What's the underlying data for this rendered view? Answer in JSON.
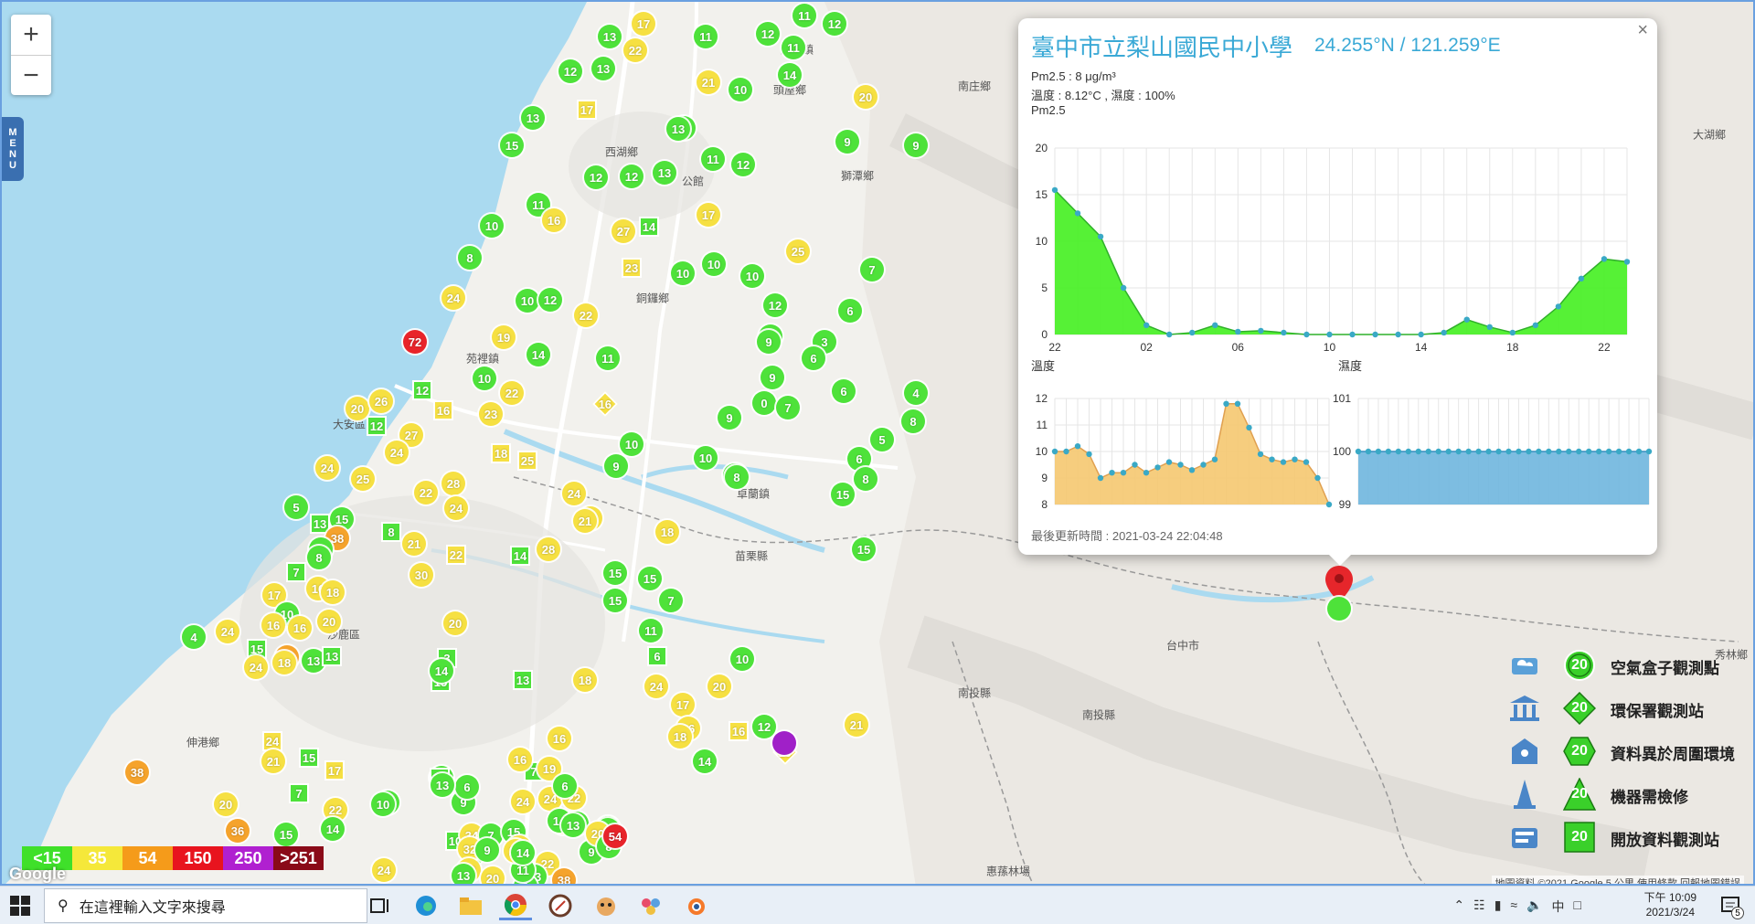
{
  "map": {
    "zoom_in": "+",
    "zoom_out": "−",
    "menu_label": "MENU",
    "places": [
      {
        "name": "通霄鎮"
      },
      {
        "name": "南庄鄉"
      },
      {
        "name": "頭屋鄉"
      },
      {
        "name": "西湖鄉"
      },
      {
        "name": "獅潭鄉"
      },
      {
        "name": "公館"
      },
      {
        "name": "大湖鄉"
      },
      {
        "name": "銅鑼鄉"
      },
      {
        "name": "苑裡鎮"
      },
      {
        "name": "大安區"
      },
      {
        "name": "卓蘭鎮"
      },
      {
        "name": "苗栗縣"
      },
      {
        "name": "台中市"
      },
      {
        "name": "沙鹿區"
      },
      {
        "name": "伸港鄉"
      },
      {
        "name": "南投縣"
      },
      {
        "name": "南投縣"
      },
      {
        "name": "惠蓀林場"
      },
      {
        "name": "秀林鄉"
      }
    ],
    "markers": [
      {
        "v": "13",
        "lv": 1,
        "t": "c"
      },
      {
        "v": "17",
        "lv": 2,
        "t": "c"
      },
      {
        "v": "22",
        "lv": 2,
        "t": "c"
      },
      {
        "v": "11",
        "lv": 1,
        "t": "c"
      },
      {
        "v": "12",
        "lv": 1,
        "t": "c"
      },
      {
        "v": "11",
        "lv": 1,
        "t": "c"
      },
      {
        "v": "12",
        "lv": 1,
        "t": "c"
      },
      {
        "v": "11",
        "lv": 1,
        "t": "c"
      },
      {
        "v": "14",
        "lv": 1,
        "t": "c"
      },
      {
        "v": "13",
        "lv": 1,
        "t": "c"
      },
      {
        "v": "12",
        "lv": 1,
        "t": "c"
      },
      {
        "v": "13",
        "lv": 1,
        "t": "c"
      },
      {
        "v": "15",
        "lv": 1,
        "t": "c"
      },
      {
        "v": "17",
        "lv": 2,
        "t": "s"
      },
      {
        "v": "21",
        "lv": 2,
        "t": "c"
      },
      {
        "v": "10",
        "lv": 1,
        "t": "c"
      },
      {
        "v": "20",
        "lv": 2,
        "t": "c"
      },
      {
        "v": "12",
        "lv": 1,
        "t": "c"
      },
      {
        "v": "13",
        "lv": 1,
        "t": "c"
      },
      {
        "v": "9",
        "lv": 1,
        "t": "c"
      },
      {
        "v": "9",
        "lv": 1,
        "t": "c"
      },
      {
        "v": "11",
        "lv": 1,
        "t": "c"
      },
      {
        "v": "12",
        "lv": 1,
        "t": "c"
      },
      {
        "v": "12",
        "lv": 1,
        "t": "c"
      },
      {
        "v": "12",
        "lv": 1,
        "t": "c"
      },
      {
        "v": "13",
        "lv": 1,
        "t": "c"
      },
      {
        "v": "10",
        "lv": 1,
        "t": "c"
      },
      {
        "v": "11",
        "lv": 1,
        "t": "c"
      },
      {
        "v": "16",
        "lv": 2,
        "t": "c"
      },
      {
        "v": "27",
        "lv": 2,
        "t": "c"
      },
      {
        "v": "14",
        "lv": 1,
        "t": "s"
      },
      {
        "v": "17",
        "lv": 2,
        "t": "c"
      },
      {
        "v": "8",
        "lv": 1,
        "t": "c"
      },
      {
        "v": "23",
        "lv": 2,
        "t": "s"
      },
      {
        "v": "10",
        "lv": 1,
        "t": "c"
      },
      {
        "v": "10",
        "lv": 1,
        "t": "c"
      },
      {
        "v": "10",
        "lv": 1,
        "t": "c"
      },
      {
        "v": "25",
        "lv": 2,
        "t": "c"
      },
      {
        "v": "7",
        "lv": 1,
        "t": "c"
      },
      {
        "v": "72",
        "lv": 4,
        "t": "c"
      },
      {
        "v": "24",
        "lv": 2,
        "t": "c"
      },
      {
        "v": "10",
        "lv": 1,
        "t": "c"
      },
      {
        "v": "12",
        "lv": 1,
        "t": "c"
      },
      {
        "v": "22",
        "lv": 2,
        "t": "c"
      },
      {
        "v": "12",
        "lv": 1,
        "t": "c"
      },
      {
        "v": "6",
        "lv": 1,
        "t": "c"
      },
      {
        "v": "9",
        "lv": 1,
        "t": "c"
      },
      {
        "v": "9",
        "lv": 1,
        "t": "c"
      },
      {
        "v": "3",
        "lv": 1,
        "t": "c"
      },
      {
        "v": "6",
        "lv": 1,
        "t": "c"
      },
      {
        "v": "19",
        "lv": 2,
        "t": "c"
      },
      {
        "v": "10",
        "lv": 1,
        "t": "c"
      },
      {
        "v": "14",
        "lv": 1,
        "t": "c"
      },
      {
        "v": "11",
        "lv": 1,
        "t": "c"
      },
      {
        "v": "12",
        "lv": 1,
        "t": "s"
      },
      {
        "v": "22",
        "lv": 2,
        "t": "c"
      },
      {
        "v": "16",
        "lv": 2,
        "t": "d"
      },
      {
        "v": "9",
        "lv": 1,
        "t": "c"
      },
      {
        "v": "9",
        "lv": 1,
        "t": "c"
      },
      {
        "v": "0",
        "lv": 1,
        "t": "c"
      },
      {
        "v": "7",
        "lv": 1,
        "t": "c"
      },
      {
        "v": "6",
        "lv": 1,
        "t": "c"
      },
      {
        "v": "4",
        "lv": 1,
        "t": "c"
      },
      {
        "v": "8",
        "lv": 1,
        "t": "c"
      },
      {
        "v": "20",
        "lv": 2,
        "t": "c"
      },
      {
        "v": "26",
        "lv": 2,
        "t": "c"
      },
      {
        "v": "12",
        "lv": 1,
        "t": "s"
      },
      {
        "v": "27",
        "lv": 2,
        "t": "c"
      },
      {
        "v": "16",
        "lv": 2,
        "t": "s"
      },
      {
        "v": "23",
        "lv": 2,
        "t": "c"
      },
      {
        "v": "10",
        "lv": 1,
        "t": "c"
      },
      {
        "v": "9",
        "lv": 1,
        "t": "c"
      },
      {
        "v": "5",
        "lv": 1,
        "t": "c"
      },
      {
        "v": "6",
        "lv": 1,
        "t": "c"
      },
      {
        "v": "8",
        "lv": 1,
        "t": "c"
      },
      {
        "v": "24",
        "lv": 2,
        "t": "c"
      },
      {
        "v": "25",
        "lv": 2,
        "t": "c"
      },
      {
        "v": "24",
        "lv": 2,
        "t": "c"
      },
      {
        "v": "18",
        "lv": 2,
        "t": "s"
      },
      {
        "v": "25",
        "lv": 2,
        "t": "s"
      },
      {
        "v": "10",
        "lv": 1,
        "t": "c"
      },
      {
        "v": "9",
        "lv": 1,
        "t": "c"
      },
      {
        "v": "8",
        "lv": 1,
        "t": "c"
      },
      {
        "v": "15",
        "lv": 1,
        "t": "c"
      },
      {
        "v": "22",
        "lv": 2,
        "t": "c"
      },
      {
        "v": "28",
        "lv": 2,
        "t": "c"
      },
      {
        "v": "24",
        "lv": 2,
        "t": "c"
      },
      {
        "v": "18",
        "lv": 2,
        "t": "c"
      },
      {
        "v": "13",
        "lv": 1,
        "t": "s"
      },
      {
        "v": "15",
        "lv": 1,
        "t": "c"
      },
      {
        "v": "38",
        "lv": 3,
        "t": "c"
      },
      {
        "v": "8",
        "lv": 1,
        "t": "s"
      },
      {
        "v": "21",
        "lv": 2,
        "t": "c"
      },
      {
        "v": "24",
        "lv": 2,
        "t": "c"
      },
      {
        "v": "21",
        "lv": 2,
        "t": "c"
      },
      {
        "v": "18",
        "lv": 2,
        "t": "c"
      },
      {
        "v": "15",
        "lv": 1,
        "t": "c"
      },
      {
        "v": "9",
        "lv": 1,
        "t": "c"
      },
      {
        "v": "5",
        "lv": 1,
        "t": "c"
      },
      {
        "v": "8",
        "lv": 1,
        "t": "c"
      },
      {
        "v": "22",
        "lv": 2,
        "t": "s"
      },
      {
        "v": "14",
        "lv": 1,
        "t": "s"
      },
      {
        "v": "28",
        "lv": 2,
        "t": "c"
      },
      {
        "v": "15",
        "lv": 1,
        "t": "c"
      },
      {
        "v": "7",
        "lv": 1,
        "t": "s"
      },
      {
        "v": "30",
        "lv": 2,
        "t": "c"
      },
      {
        "v": "16",
        "lv": 2,
        "t": "c"
      },
      {
        "v": "18",
        "lv": 2,
        "t": "c"
      },
      {
        "v": "15",
        "lv": 1,
        "t": "c"
      },
      {
        "v": "15",
        "lv": 1,
        "t": "c"
      },
      {
        "v": "17",
        "lv": 2,
        "t": "c"
      },
      {
        "v": "10",
        "lv": 1,
        "t": "c"
      },
      {
        "v": "16",
        "lv": 2,
        "t": "c"
      },
      {
        "v": "20",
        "lv": 2,
        "t": "c"
      },
      {
        "v": "16",
        "lv": 2,
        "t": "c"
      },
      {
        "v": "4",
        "lv": 1,
        "t": "c"
      },
      {
        "v": "24",
        "lv": 2,
        "t": "c"
      },
      {
        "v": "15",
        "lv": 1,
        "t": "s"
      },
      {
        "v": "45",
        "lv": 3,
        "t": "c"
      },
      {
        "v": "13",
        "lv": 1,
        "t": "c"
      },
      {
        "v": "24",
        "lv": 2,
        "t": "c"
      },
      {
        "v": "18",
        "lv": 2,
        "t": "c"
      },
      {
        "v": "13",
        "lv": 1,
        "t": "s"
      },
      {
        "v": "20",
        "lv": 2,
        "t": "c"
      },
      {
        "v": "3",
        "lv": 1,
        "t": "s"
      },
      {
        "v": "15",
        "lv": 1,
        "t": "s"
      },
      {
        "v": "14",
        "lv": 1,
        "t": "c"
      },
      {
        "v": "11",
        "lv": 1,
        "t": "c"
      },
      {
        "v": "7",
        "lv": 1,
        "t": "c"
      },
      {
        "v": "13",
        "lv": 1,
        "t": "s"
      },
      {
        "v": "18",
        "lv": 2,
        "t": "c"
      },
      {
        "v": "6",
        "lv": 1,
        "t": "s"
      },
      {
        "v": "10",
        "lv": 1,
        "t": "c"
      },
      {
        "v": "24",
        "lv": 2,
        "t": "c"
      },
      {
        "v": "20",
        "lv": 2,
        "t": "c"
      },
      {
        "v": "17",
        "lv": 2,
        "t": "c"
      },
      {
        "v": "16",
        "lv": 2,
        "t": "c"
      },
      {
        "v": "18",
        "lv": 2,
        "t": "c"
      },
      {
        "v": "12",
        "lv": 1,
        "t": "c"
      },
      {
        "v": "16",
        "lv": 2,
        "t": "s"
      },
      {
        "v": "19",
        "lv": 2,
        "t": "d"
      },
      {
        "v": "38",
        "lv": 3,
        "t": "c"
      },
      {
        "v": "20",
        "lv": 2,
        "t": "c"
      },
      {
        "v": "36",
        "lv": 3,
        "t": "c"
      },
      {
        "v": "24",
        "lv": 2,
        "t": "s"
      },
      {
        "v": "21",
        "lv": 2,
        "t": "c"
      },
      {
        "v": "15",
        "lv": 1,
        "t": "s"
      },
      {
        "v": "17",
        "lv": 2,
        "t": "s"
      },
      {
        "v": "7",
        "lv": 1,
        "t": "s"
      },
      {
        "v": "13",
        "lv": 1,
        "t": "c"
      },
      {
        "v": "15",
        "lv": 1,
        "t": "c"
      },
      {
        "v": "22",
        "lv": 2,
        "t": "c"
      },
      {
        "v": "10",
        "lv": 1,
        "t": "c"
      },
      {
        "v": "13",
        "lv": 1,
        "t": "c"
      },
      {
        "v": "15",
        "lv": 1,
        "t": "s"
      },
      {
        "v": "14",
        "lv": 1,
        "t": "c"
      },
      {
        "v": "10",
        "lv": 1,
        "t": "s"
      },
      {
        "v": "34",
        "lv": 2,
        "t": "c"
      },
      {
        "v": "9",
        "lv": 1,
        "t": "c"
      },
      {
        "v": "7",
        "lv": 1,
        "t": "c"
      },
      {
        "v": "24",
        "lv": 2,
        "t": "c"
      },
      {
        "v": "12",
        "lv": 1,
        "t": "c"
      },
      {
        "v": "7",
        "lv": 1,
        "t": "s"
      },
      {
        "v": "19",
        "lv": 2,
        "t": "c"
      },
      {
        "v": "16",
        "lv": 2,
        "t": "c"
      },
      {
        "v": "16",
        "lv": 2,
        "t": "c"
      },
      {
        "v": "24",
        "lv": 2,
        "t": "c"
      },
      {
        "v": "22",
        "lv": 2,
        "t": "c"
      },
      {
        "v": "18",
        "lv": 2,
        "t": "c"
      },
      {
        "v": "14",
        "lv": 1,
        "t": "c"
      },
      {
        "v": "15",
        "lv": 1,
        "t": "c"
      },
      {
        "v": "10",
        "lv": 1,
        "t": "c"
      },
      {
        "v": "7",
        "lv": 1,
        "t": "c"
      },
      {
        "v": "8",
        "lv": 1,
        "t": "c"
      },
      {
        "v": "13",
        "lv": 1,
        "t": "c"
      },
      {
        "v": "6",
        "lv": 1,
        "t": "c"
      },
      {
        "v": "9",
        "lv": 1,
        "t": "c"
      },
      {
        "v": "21",
        "lv": 2,
        "t": "c"
      },
      {
        "v": "",
        "lv": 5,
        "t": "c"
      },
      {
        "v": "14",
        "lv": 1,
        "t": "c"
      },
      {
        "v": "20",
        "lv": 2,
        "t": "c"
      },
      {
        "v": "22",
        "lv": 2,
        "t": "c"
      },
      {
        "v": "38",
        "lv": 3,
        "t": "c"
      },
      {
        "v": "32",
        "lv": 2,
        "t": "c"
      },
      {
        "v": "15",
        "lv": 1,
        "t": "c"
      },
      {
        "v": "9",
        "lv": 1,
        "t": "c"
      },
      {
        "v": "13",
        "lv": 1,
        "t": "c"
      },
      {
        "v": "6",
        "lv": 1,
        "t": "c"
      },
      {
        "v": "9",
        "lv": 1,
        "t": "c"
      },
      {
        "v": "11",
        "lv": 1,
        "t": "c"
      },
      {
        "v": "8",
        "lv": 1,
        "t": "c"
      },
      {
        "v": "54",
        "lv": 4,
        "t": "c"
      },
      {
        "v": "22",
        "lv": 2,
        "t": "c"
      },
      {
        "v": "25",
        "lv": 2,
        "t": "c"
      },
      {
        "v": "14",
        "lv": 1,
        "t": "c"
      },
      {
        "v": "13",
        "lv": 1,
        "t": "c"
      },
      {
        "v": "24",
        "lv": 2,
        "t": "c"
      },
      {
        "v": "22",
        "lv": 2,
        "t": "c"
      },
      {
        "v": "13",
        "lv": 1,
        "t": "c"
      },
      {
        "v": "20",
        "lv": 2,
        "t": "c"
      }
    ]
  },
  "popup": {
    "close_label": "×",
    "title": "臺中市立梨山國民中小學",
    "coords": "24.255°N / 121.259°E",
    "pm25_line": "Pm2.5 : 8 μg/m³",
    "env_line": "溫度 : 8.12°C , 濕度 : 100%",
    "chart_label": "Pm2.5",
    "temp_label": "溫度",
    "hum_label": "濕度",
    "updated": "最後更新時間 : 2021-03-24 22:04:48"
  },
  "chart_data": [
    {
      "type": "area",
      "title": "Pm2.5",
      "x": [
        "22",
        "",
        "",
        "",
        "02",
        "",
        "",
        "",
        "06",
        "",
        "",
        "",
        "10",
        "",
        "",
        "",
        "14",
        "",
        "",
        "",
        "18",
        "",
        "",
        "",
        "22"
      ],
      "xticks": [
        "22",
        "02",
        "06",
        "10",
        "14",
        "18",
        "22"
      ],
      "values": [
        15.5,
        13,
        10.5,
        5,
        1,
        0,
        0.2,
        1,
        0.3,
        0.4,
        0.2,
        0,
        0,
        0,
        0,
        0,
        0,
        0.2,
        1.6,
        0.8,
        0.2,
        1,
        3,
        6,
        8.1,
        7.8
      ],
      "ylim": [
        0,
        20
      ],
      "yticks": [
        0,
        5,
        10,
        15,
        20
      ],
      "color": "#44f020"
    },
    {
      "type": "area",
      "title": "溫度",
      "values": [
        10,
        10,
        10.2,
        9.9,
        9,
        9.2,
        9.2,
        9.5,
        9.2,
        9.4,
        9.6,
        9.5,
        9.3,
        9.5,
        9.7,
        11.8,
        11.8,
        10.9,
        9.9,
        9.7,
        9.6,
        9.7,
        9.6,
        9.0,
        8.0
      ],
      "ylim": [
        8,
        12
      ],
      "yticks": [
        8,
        9,
        10,
        11,
        12
      ],
      "color": "#f5c870"
    },
    {
      "type": "area",
      "title": "濕度",
      "values": [
        100,
        100,
        100,
        100,
        100,
        100,
        100,
        100,
        100,
        100,
        100,
        100,
        100,
        100,
        100,
        100,
        100,
        100,
        100,
        100,
        100,
        100,
        100,
        100,
        100,
        100,
        100,
        100,
        100,
        100
      ],
      "ylim": [
        99,
        101
      ],
      "yticks": [
        99,
        100,
        101
      ],
      "color": "#6fb6de"
    }
  ],
  "scale": {
    "items": [
      {
        "label": "<15",
        "color": "#3fe02a"
      },
      {
        "label": "35",
        "color": "#f5e83a"
      },
      {
        "label": "54",
        "color": "#f59b1a"
      },
      {
        "label": "150",
        "color": "#e8141e"
      },
      {
        "label": "250",
        "color": "#b020d0"
      },
      {
        "label": ">251",
        "color": "#8a0a18"
      }
    ]
  },
  "legend": {
    "items": [
      {
        "label": "空氣盒子觀測點",
        "value": "20",
        "shape": "circle",
        "icon": "cloud-box-icon"
      },
      {
        "label": "環保署觀測站",
        "value": "20",
        "shape": "diamond",
        "icon": "government-building-icon"
      },
      {
        "label": "資料異於周圍環境",
        "value": "20",
        "shape": "hexagon",
        "icon": "house-alert-icon"
      },
      {
        "label": "機器需檢修",
        "value": "20",
        "shape": "triangle",
        "icon": "traffic-cone-icon"
      },
      {
        "label": "開放資料觀測站",
        "value": "20",
        "shape": "square",
        "icon": "open-data-icon"
      }
    ]
  },
  "attribution": "地圖資料 ©2021 Google   5 公里        使用條款   回報地圖錯誤",
  "google_logo": "Google",
  "taskbar": {
    "search_placeholder": "在這裡輸入文字來搜尋",
    "time": "下午 10:09",
    "date": "2021/3/24",
    "ime": "中",
    "notification_count": "5"
  }
}
